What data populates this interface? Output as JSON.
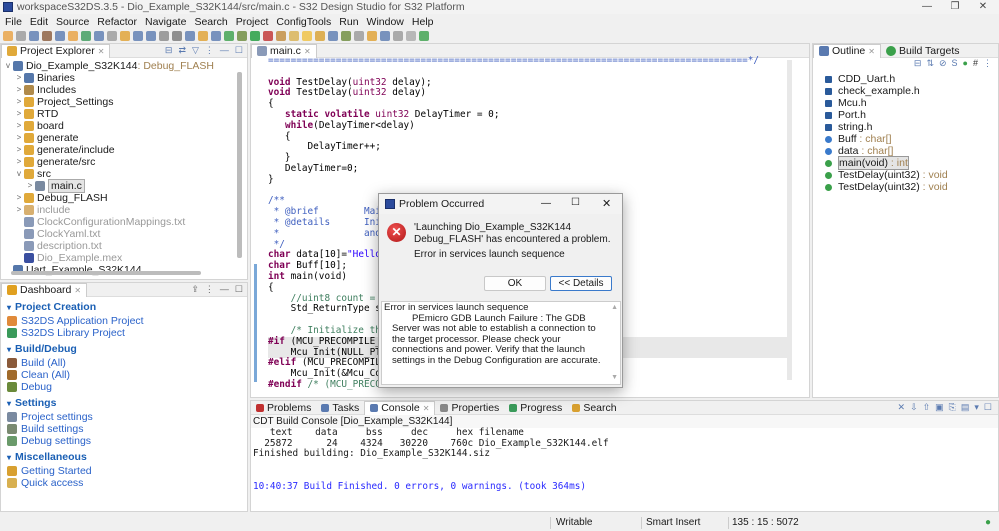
{
  "window": {
    "title": "workspaceS32DS.3.5 - Dio_Example_S32K144/src/main.c - S32 Design Studio for S32 Platform"
  },
  "menu": [
    "File",
    "Edit",
    "Source",
    "Refactor",
    "Navigate",
    "Search",
    "Project",
    "ConfigTools",
    "Run",
    "Window",
    "Help"
  ],
  "project_explorer": {
    "tab": "Project Explorer",
    "project": "Dio_Example_S32K144",
    "project_config": ": Debug_FLASH",
    "items": [
      {
        "label": "Binaries",
        "indent": 1,
        "chev": ">",
        "icon": "binaries-icon",
        "color": "#5577aa"
      },
      {
        "label": "Includes",
        "indent": 1,
        "chev": ">",
        "icon": "includes-icon",
        "color": "#b08a4a"
      },
      {
        "label": "Project_Settings",
        "indent": 1,
        "chev": ">",
        "icon": "folder-icon",
        "color": "#e0a93a"
      },
      {
        "label": "RTD",
        "indent": 1,
        "chev": ">",
        "icon": "folder-icon",
        "color": "#e0a93a"
      },
      {
        "label": "board",
        "indent": 1,
        "chev": ">",
        "icon": "folder-icon",
        "color": "#e0a93a"
      },
      {
        "label": "generate",
        "indent": 1,
        "chev": ">",
        "icon": "folder-icon",
        "color": "#e0a93a"
      },
      {
        "label": "generate/include",
        "indent": 1,
        "chev": ">",
        "icon": "folder-icon",
        "color": "#e0a93a"
      },
      {
        "label": "generate/src",
        "indent": 1,
        "chev": ">",
        "icon": "folder-icon",
        "color": "#e0a93a"
      },
      {
        "label": "src",
        "indent": 1,
        "chev": "v",
        "icon": "folder-icon",
        "color": "#e0a93a"
      },
      {
        "label": "main.c",
        "indent": 2,
        "chev": ">",
        "icon": "c-file-icon",
        "color": "#7a8aa0",
        "selected": true
      },
      {
        "label": "Debug_FLASH",
        "indent": 1,
        "chev": ">",
        "icon": "folder-icon",
        "color": "#e0a93a"
      },
      {
        "label": "include",
        "indent": 1,
        "chev": ">",
        "icon": "folder-icon",
        "color": "#d8b070",
        "dim": true
      },
      {
        "label": "ClockConfigurationMappings.txt",
        "indent": 1,
        "chev": "",
        "icon": "text-file-icon",
        "color": "#8a9ab8",
        "dim": true
      },
      {
        "label": "ClockYaml.txt",
        "indent": 1,
        "chev": "",
        "icon": "text-file-icon",
        "color": "#8a9ab8",
        "dim": true
      },
      {
        "label": "description.txt",
        "indent": 1,
        "chev": "",
        "icon": "text-file-icon",
        "color": "#8a9ab8",
        "dim": true
      },
      {
        "label": "Dio_Example.mex",
        "indent": 1,
        "chev": "",
        "icon": "mex-file-icon",
        "color": "#3a4fa0",
        "dim": true
      },
      {
        "label": "Uart_Example_S32K144",
        "indent": 0,
        "chev": "",
        "icon": "project-icon",
        "color": "#5577aa"
      }
    ]
  },
  "dashboard": {
    "tab": "Dashboard",
    "sections": [
      {
        "title": "Project Creation",
        "links": [
          {
            "label": "S32DS Application Project",
            "color": "#e08a3a"
          },
          {
            "label": "S32DS Library Project",
            "color": "#3a9a5a"
          }
        ]
      },
      {
        "title": "Build/Debug",
        "links": [
          {
            "label": "Build  (All)",
            "color": "#8a5a3a"
          },
          {
            "label": "Clean  (All)",
            "color": "#a06a2a"
          },
          {
            "label": "Debug",
            "color": "#6a8a3a"
          }
        ]
      },
      {
        "title": "Settings",
        "links": [
          {
            "label": "Project settings",
            "color": "#7a8aa0"
          },
          {
            "label": "Build settings",
            "color": "#7a8a70"
          },
          {
            "label": "Debug settings",
            "color": "#6a9a6a"
          }
        ]
      },
      {
        "title": "Miscellaneous",
        "links": [
          {
            "label": "Getting Started",
            "color": "#d8a030"
          },
          {
            "label": "Quick access",
            "color": "#d8b050"
          }
        ]
      }
    ]
  },
  "editor": {
    "tab": "main.c",
    "lines": [
      [
        [
          "=====================================================================================*/",
          "dc"
        ]
      ],
      [],
      [
        [
          "void",
          "kw"
        ],
        [
          " TestDelay(",
          ""
        ],
        [
          "uint32",
          "ty"
        ],
        [
          " delay);",
          ""
        ]
      ],
      [
        [
          "void",
          "kw"
        ],
        [
          " TestDelay(",
          ""
        ],
        [
          "uint32",
          "ty"
        ],
        [
          " delay)",
          ""
        ]
      ],
      [
        [
          "{",
          ""
        ]
      ],
      [
        [
          "   ",
          ""
        ],
        [
          "static",
          "kw"
        ],
        [
          " ",
          ""
        ],
        [
          "volatile",
          "kw"
        ],
        [
          " ",
          ""
        ],
        [
          "uint32",
          "ty"
        ],
        [
          " DelayTimer = 0;",
          ""
        ]
      ],
      [
        [
          "   ",
          ""
        ],
        [
          "while",
          "kw"
        ],
        [
          "(DelayTimer<delay)",
          ""
        ]
      ],
      [
        [
          "   {",
          ""
        ]
      ],
      [
        [
          "       DelayTimer++;",
          ""
        ]
      ],
      [
        [
          "   }",
          ""
        ]
      ],
      [
        [
          "   DelayTimer=0;",
          ""
        ]
      ],
      [
        [
          "}",
          ""
        ]
      ],
      [],
      [
        [
          "/**",
          "dc"
        ]
      ],
      [
        [
          " * @brief        Main fu",
          "dc"
        ]
      ],
      [
        [
          " * @details      Initial",
          "dc"
        ]
      ],
      [
        [
          " *               and Dio",
          "dc"
        ]
      ],
      [
        [
          " */",
          "dc"
        ]
      ],
      [
        [
          "char",
          "kw"
        ],
        [
          " data[10]=",
          ""
        ],
        [
          "\"Hello\\r\\",
          "st"
        ]
      ],
      [
        [
          "char",
          "kw"
        ],
        [
          " Buff[10];",
          ""
        ]
      ],
      [
        [
          "int",
          "kw"
        ],
        [
          " main(void)",
          ""
        ]
      ],
      [
        [
          "{",
          ""
        ]
      ],
      [
        [
          "    ",
          ""
        ],
        [
          "//uint8 count = 0U;",
          "cm"
        ]
      ],
      [
        [
          "    Std_ReturnType stat",
          ""
        ]
      ],
      [],
      [
        [
          "    ",
          ""
        ],
        [
          "/* Initialize the M",
          "cm"
        ]
      ],
      [
        [
          "#if",
          "pp"
        ],
        [
          " (MCU_PRECOMPILE_SUP",
          ""
        ]
      ],
      [
        [
          "    Mcu_Init(NULL_PTR);",
          ""
        ]
      ],
      [
        [
          "#elif",
          "pp"
        ],
        [
          " (MCU_PRECOMPILE_S",
          ""
        ]
      ],
      [
        [
          "    Mcu_Init(&Mcu_Confi",
          ""
        ]
      ],
      [
        [
          "#endif",
          "pp"
        ],
        [
          " ",
          ""
        ],
        [
          "/* (MCU_PRECOMPI",
          "cm"
        ]
      ]
    ]
  },
  "outline": {
    "tab": "Outline",
    "tab2": "Build Targets",
    "items": [
      {
        "name": "CDD_Uart.h",
        "type": "",
        "icon": "include-icon",
        "color": "#2a5a9a"
      },
      {
        "name": "check_example.h",
        "type": "",
        "icon": "include-icon",
        "color": "#2a5a9a"
      },
      {
        "name": "Mcu.h",
        "type": "",
        "icon": "include-icon",
        "color": "#2a5a9a"
      },
      {
        "name": "Port.h",
        "type": "",
        "icon": "include-icon",
        "color": "#2a5a9a"
      },
      {
        "name": "string.h",
        "type": "",
        "icon": "include-icon",
        "color": "#2a5a9a"
      },
      {
        "name": "Buff",
        "type": " : char[]",
        "icon": "variable-icon",
        "color": "#3a7acb"
      },
      {
        "name": "data",
        "type": " : char[]",
        "icon": "variable-icon",
        "color": "#3a7acb"
      },
      {
        "name": "main(void)",
        "type": " : int",
        "icon": "function-icon",
        "color": "#3aa04a",
        "selected": true
      },
      {
        "name": "TestDelay(uint32)",
        "type": " : void",
        "icon": "function-decl-icon",
        "color": "#3aa04a"
      },
      {
        "name": "TestDelay(uint32)",
        "type": " : void",
        "icon": "function-icon",
        "color": "#3aa04a"
      }
    ]
  },
  "console": {
    "tabs": [
      "Problems",
      "Tasks",
      "Console",
      "Properties",
      "Progress",
      "Search"
    ],
    "title": "CDT Build Console [Dio_Example_S32K144]",
    "lines": [
      "   text    data     bss     dec     hex filename",
      "  25872      24    4324   30220    760c Dio_Example_S32K144.elf",
      "Finished building: Dio_Example_S32K144.siz",
      "",
      ""
    ],
    "finish": "10:40:37 Build Finished. 0 errors, 0 warnings. (took 364ms)"
  },
  "dialog": {
    "title": "Problem Occurred",
    "message": "'Launching Dio_Example_S32K144 Debug_FLASH' has encountered a problem.",
    "reason": "Error in services launch sequence",
    "ok": "OK",
    "details": "<< Details",
    "details_heading": "Error in services launch sequence",
    "details_text": "PEmicro GDB Launch Failure : The GDB Server was not able to establish a connection to the target processor. Please check your connections and power. Verify that the launch settings in the Debug Configuration are accurate."
  },
  "status": {
    "writable": "Writable",
    "insert": "Smart Insert",
    "position": "135 : 15 : 5072"
  }
}
